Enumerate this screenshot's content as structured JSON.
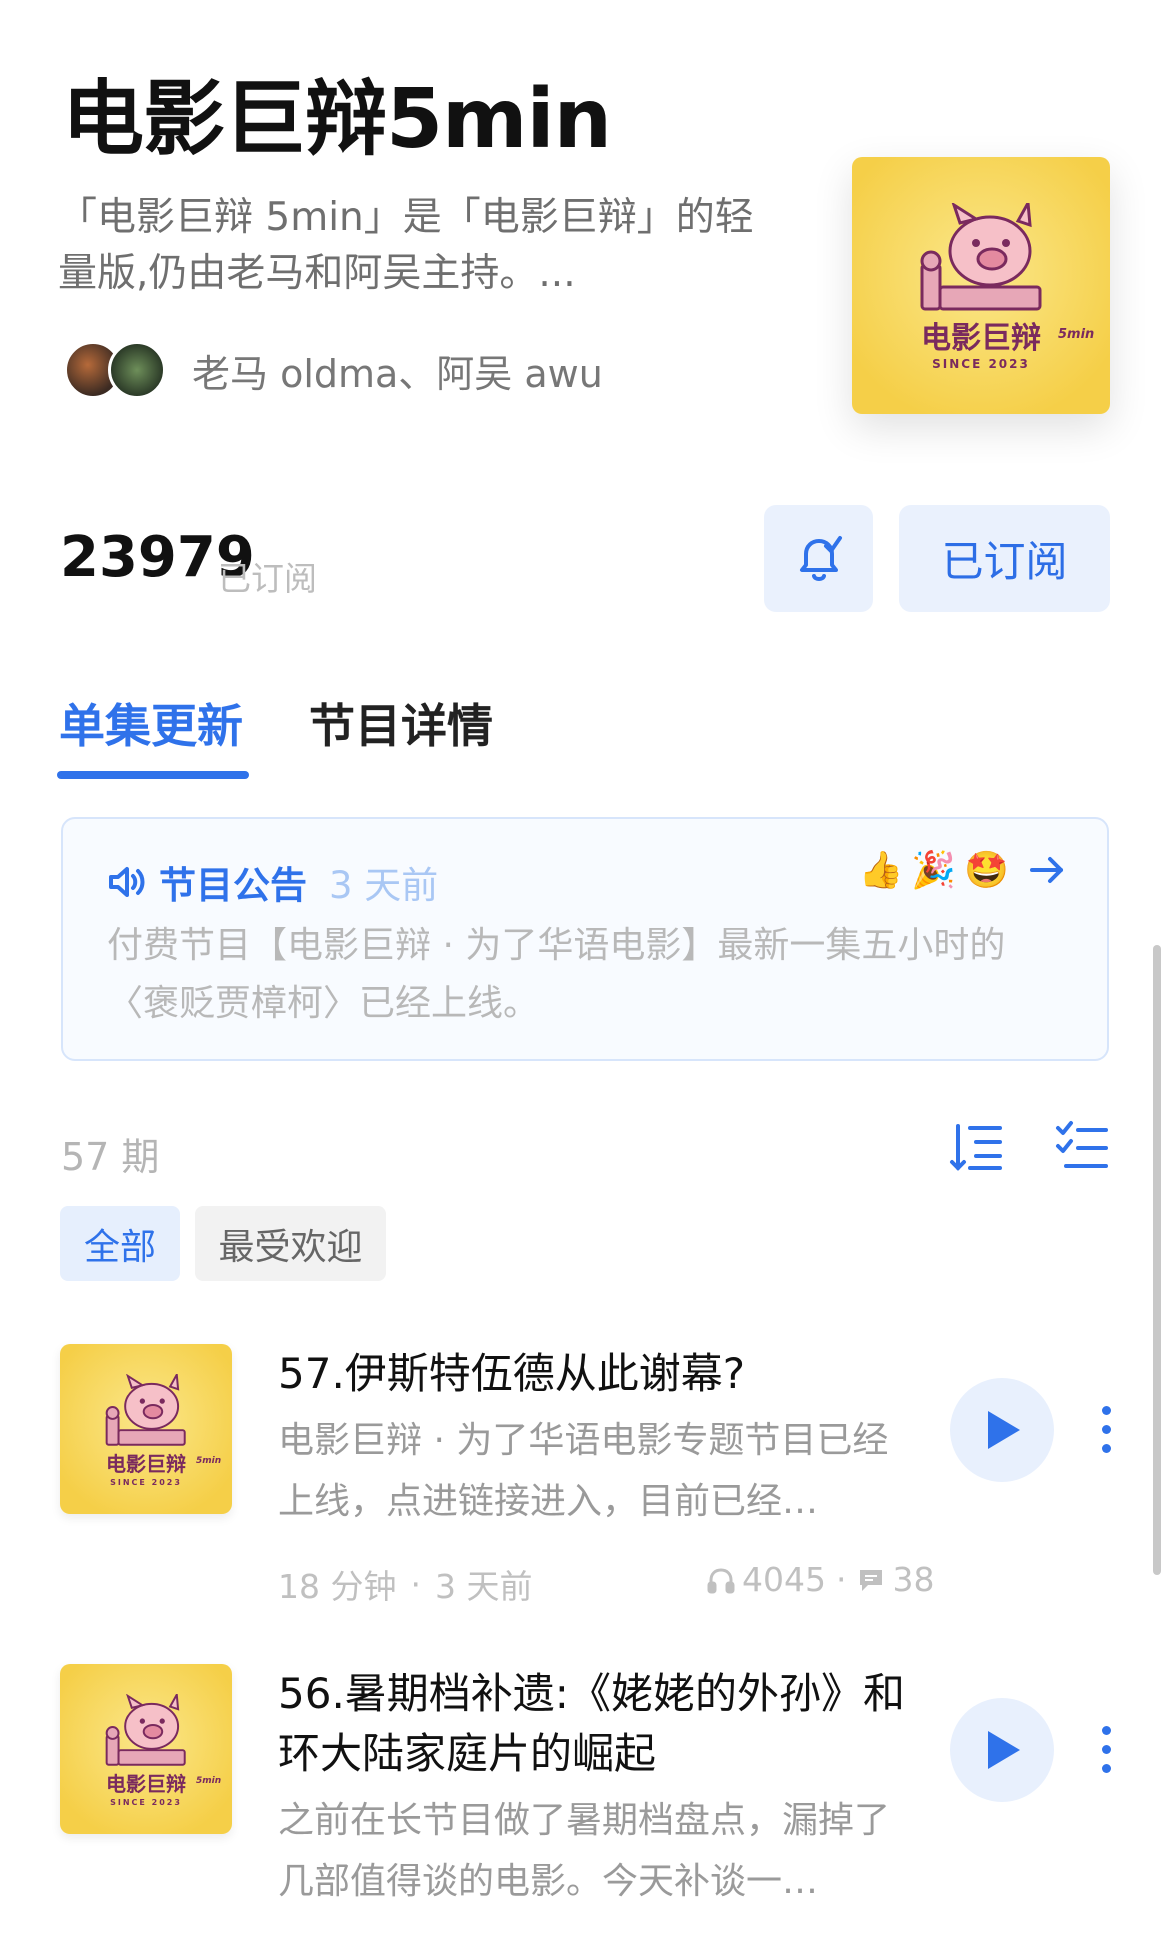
{
  "podcast": {
    "title": "电影巨辩5min",
    "description": "「电影巨辩 5min」是「电影巨辩」的轻量版,仍由老马和阿吴主持。...",
    "hosts": "老马 oldma、阿吴 awu",
    "cover": {
      "title": "电影巨辩",
      "badge": "5min",
      "since": "SINCE 2023"
    }
  },
  "subscription": {
    "count": "23979",
    "count_label": "已订阅",
    "subscribed_label": "已订阅"
  },
  "tabs": [
    {
      "label": "单集更新",
      "active": true
    },
    {
      "label": "节目详情",
      "active": false
    }
  ],
  "notice": {
    "title": "节目公告",
    "time": "3 天前",
    "emojis": [
      "👍",
      "🎉",
      "🤩"
    ],
    "body": "付费节目【电影巨辩 · 为了华语电影】最新一集五小时的〈褒贬贾樟柯〉已经上线。"
  },
  "episode_count": "57 期",
  "filters": [
    {
      "label": "全部",
      "active": true
    },
    {
      "label": "最受欢迎",
      "active": false
    }
  ],
  "episodes": [
    {
      "title": "57.伊斯特伍德从此谢幕?",
      "description": "电影巨辩 · 为了华语电影专题节目已经上线，点进链接进入，目前已经…",
      "duration": "18 分钟",
      "published": "3 天前",
      "plays": "4045",
      "comments": "38"
    },
    {
      "title": "56.暑期档补遗:《姥姥的外孙》和环大陆家庭片的崛起",
      "description": "之前在长节目做了暑期档盘点，漏掉了几部值得谈的电影。今天补谈一…"
    }
  ],
  "colors": {
    "accent": "#2f72ea",
    "cover_yellow": "#f5cf48",
    "cover_text": "#7a2a5e"
  }
}
